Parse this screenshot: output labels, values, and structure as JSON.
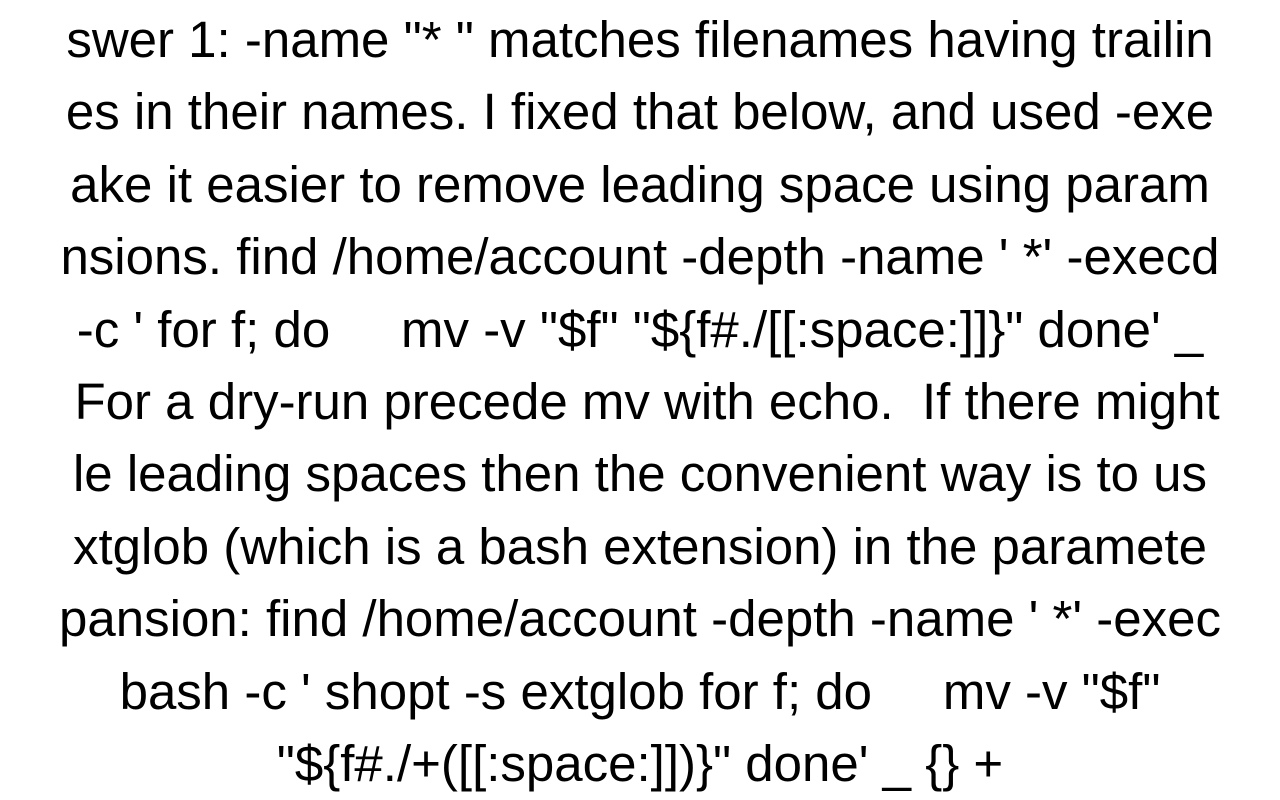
{
  "document": {
    "body_text": "swer 1: -name \"* \" matches filenames having trailin\nes in their names. I fixed that below, and used -exe\nake it easier to remove leading space using param\nnsions. find /home/account -depth -name ' *' -execd\n-c ' for f; do     mv -v \"$f\" \"${f#./[[:space:]]}\" done' _\n For a dry-run precede mv with echo.  If there might\nle leading spaces then the convenient way is to us\nxtglob (which is a bash extension) in the paramete\npansion: find /home/account -depth -name ' *' -exec\nbash -c ' shopt -s extglob for f; do     mv -v \"$f\"\n\"${f#./+([[:space:]])}\" done' _ {} +"
  }
}
